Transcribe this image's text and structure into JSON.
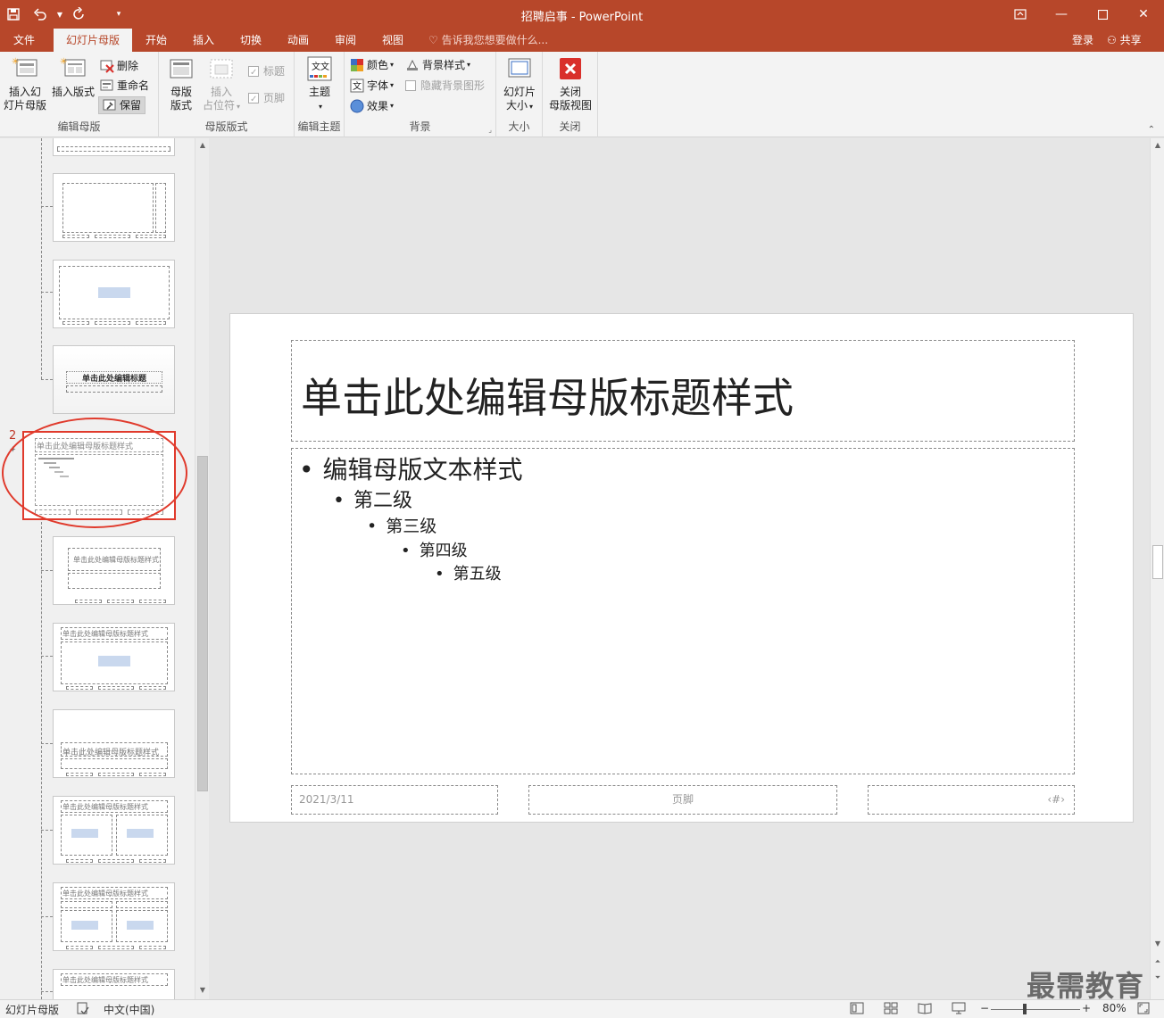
{
  "window": {
    "title": "招聘启事 - PowerPoint"
  },
  "tabs": [
    {
      "label": "文件",
      "active": false
    },
    {
      "label": "幻灯片母版",
      "active": true
    },
    {
      "label": "开始",
      "active": false
    },
    {
      "label": "插入",
      "active": false
    },
    {
      "label": "切换",
      "active": false
    },
    {
      "label": "动画",
      "active": false
    },
    {
      "label": "审阅",
      "active": false
    },
    {
      "label": "视图",
      "active": false
    }
  ],
  "tell_me": "告诉我您想要做什么...",
  "account": {
    "login": "登录",
    "share": "共享"
  },
  "ribbon": {
    "edit_master": {
      "label": "编辑母版",
      "insert_master_line1": "插入幻",
      "insert_master_line2": "灯片母版",
      "insert_layout": "插入版式",
      "delete": "删除",
      "rename": "重命名",
      "preserve": "保留"
    },
    "master_layout": {
      "label": "母版版式",
      "master_layout_line1": "母版",
      "master_layout_line2": "版式",
      "insert_placeholder_line1": "插入",
      "insert_placeholder_line2": "占位符",
      "title": "标题",
      "footer": "页脚"
    },
    "edit_theme": {
      "label": "编辑主题",
      "theme": "主题"
    },
    "background": {
      "label": "背景",
      "colors": "颜色",
      "fonts": "字体",
      "effects": "效果",
      "background_styles": "背景样式",
      "hide_background": "隐藏背景图形"
    },
    "size": {
      "label": "大小",
      "slide_size_line1": "幻灯片",
      "slide_size_line2": "大小"
    },
    "close": {
      "label": "关闭",
      "close_line1": "关闭",
      "close_line2": "母版视图"
    }
  },
  "thumbnails": {
    "master_number": "2",
    "master_title": "单击此处编辑母版标题样式",
    "layout_title": "单击此处编辑标题",
    "layout_title_2": "单击此处编辑母版标题样式"
  },
  "slide": {
    "title": "单击此处编辑母版标题样式",
    "levels": [
      "编辑母版文本样式",
      "第二级",
      "第三级",
      "第四级",
      "第五级"
    ],
    "date": "2021/3/11",
    "footer": "页脚",
    "page_number": "‹#›"
  },
  "status": {
    "view_name": "幻灯片母版",
    "language": "中文(中国)",
    "zoom": "80%"
  },
  "watermark": "最需教育",
  "colors": {
    "accent": "#b7472a",
    "highlight": "#e03a2c"
  }
}
